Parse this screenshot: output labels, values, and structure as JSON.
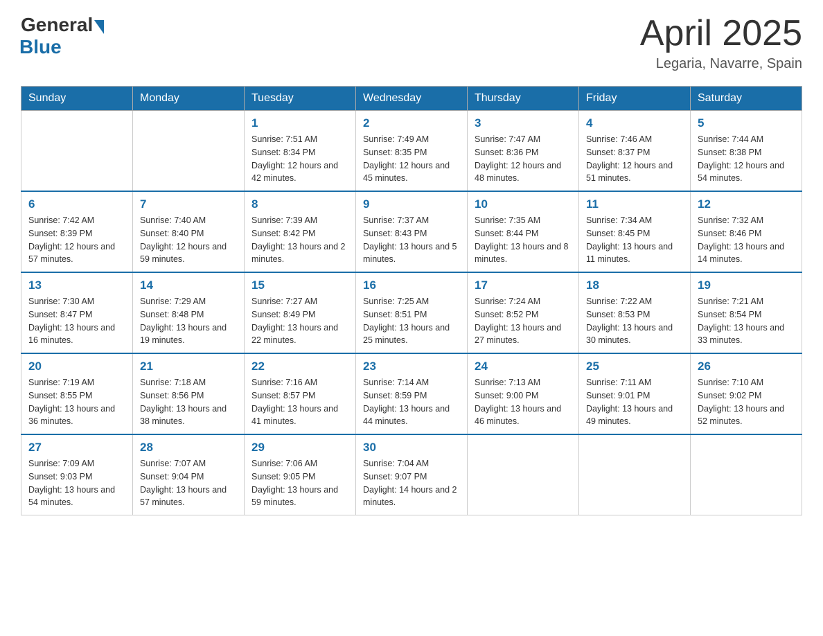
{
  "header": {
    "logo_general": "General",
    "logo_blue": "Blue",
    "title": "April 2025",
    "location": "Legaria, Navarre, Spain"
  },
  "weekdays": [
    "Sunday",
    "Monday",
    "Tuesday",
    "Wednesday",
    "Thursday",
    "Friday",
    "Saturday"
  ],
  "weeks": [
    [
      {
        "day": "",
        "sunrise": "",
        "sunset": "",
        "daylight": ""
      },
      {
        "day": "",
        "sunrise": "",
        "sunset": "",
        "daylight": ""
      },
      {
        "day": "1",
        "sunrise": "Sunrise: 7:51 AM",
        "sunset": "Sunset: 8:34 PM",
        "daylight": "Daylight: 12 hours and 42 minutes."
      },
      {
        "day": "2",
        "sunrise": "Sunrise: 7:49 AM",
        "sunset": "Sunset: 8:35 PM",
        "daylight": "Daylight: 12 hours and 45 minutes."
      },
      {
        "day": "3",
        "sunrise": "Sunrise: 7:47 AM",
        "sunset": "Sunset: 8:36 PM",
        "daylight": "Daylight: 12 hours and 48 minutes."
      },
      {
        "day": "4",
        "sunrise": "Sunrise: 7:46 AM",
        "sunset": "Sunset: 8:37 PM",
        "daylight": "Daylight: 12 hours and 51 minutes."
      },
      {
        "day": "5",
        "sunrise": "Sunrise: 7:44 AM",
        "sunset": "Sunset: 8:38 PM",
        "daylight": "Daylight: 12 hours and 54 minutes."
      }
    ],
    [
      {
        "day": "6",
        "sunrise": "Sunrise: 7:42 AM",
        "sunset": "Sunset: 8:39 PM",
        "daylight": "Daylight: 12 hours and 57 minutes."
      },
      {
        "day": "7",
        "sunrise": "Sunrise: 7:40 AM",
        "sunset": "Sunset: 8:40 PM",
        "daylight": "Daylight: 12 hours and 59 minutes."
      },
      {
        "day": "8",
        "sunrise": "Sunrise: 7:39 AM",
        "sunset": "Sunset: 8:42 PM",
        "daylight": "Daylight: 13 hours and 2 minutes."
      },
      {
        "day": "9",
        "sunrise": "Sunrise: 7:37 AM",
        "sunset": "Sunset: 8:43 PM",
        "daylight": "Daylight: 13 hours and 5 minutes."
      },
      {
        "day": "10",
        "sunrise": "Sunrise: 7:35 AM",
        "sunset": "Sunset: 8:44 PM",
        "daylight": "Daylight: 13 hours and 8 minutes."
      },
      {
        "day": "11",
        "sunrise": "Sunrise: 7:34 AM",
        "sunset": "Sunset: 8:45 PM",
        "daylight": "Daylight: 13 hours and 11 minutes."
      },
      {
        "day": "12",
        "sunrise": "Sunrise: 7:32 AM",
        "sunset": "Sunset: 8:46 PM",
        "daylight": "Daylight: 13 hours and 14 minutes."
      }
    ],
    [
      {
        "day": "13",
        "sunrise": "Sunrise: 7:30 AM",
        "sunset": "Sunset: 8:47 PM",
        "daylight": "Daylight: 13 hours and 16 minutes."
      },
      {
        "day": "14",
        "sunrise": "Sunrise: 7:29 AM",
        "sunset": "Sunset: 8:48 PM",
        "daylight": "Daylight: 13 hours and 19 minutes."
      },
      {
        "day": "15",
        "sunrise": "Sunrise: 7:27 AM",
        "sunset": "Sunset: 8:49 PM",
        "daylight": "Daylight: 13 hours and 22 minutes."
      },
      {
        "day": "16",
        "sunrise": "Sunrise: 7:25 AM",
        "sunset": "Sunset: 8:51 PM",
        "daylight": "Daylight: 13 hours and 25 minutes."
      },
      {
        "day": "17",
        "sunrise": "Sunrise: 7:24 AM",
        "sunset": "Sunset: 8:52 PM",
        "daylight": "Daylight: 13 hours and 27 minutes."
      },
      {
        "day": "18",
        "sunrise": "Sunrise: 7:22 AM",
        "sunset": "Sunset: 8:53 PM",
        "daylight": "Daylight: 13 hours and 30 minutes."
      },
      {
        "day": "19",
        "sunrise": "Sunrise: 7:21 AM",
        "sunset": "Sunset: 8:54 PM",
        "daylight": "Daylight: 13 hours and 33 minutes."
      }
    ],
    [
      {
        "day": "20",
        "sunrise": "Sunrise: 7:19 AM",
        "sunset": "Sunset: 8:55 PM",
        "daylight": "Daylight: 13 hours and 36 minutes."
      },
      {
        "day": "21",
        "sunrise": "Sunrise: 7:18 AM",
        "sunset": "Sunset: 8:56 PM",
        "daylight": "Daylight: 13 hours and 38 minutes."
      },
      {
        "day": "22",
        "sunrise": "Sunrise: 7:16 AM",
        "sunset": "Sunset: 8:57 PM",
        "daylight": "Daylight: 13 hours and 41 minutes."
      },
      {
        "day": "23",
        "sunrise": "Sunrise: 7:14 AM",
        "sunset": "Sunset: 8:59 PM",
        "daylight": "Daylight: 13 hours and 44 minutes."
      },
      {
        "day": "24",
        "sunrise": "Sunrise: 7:13 AM",
        "sunset": "Sunset: 9:00 PM",
        "daylight": "Daylight: 13 hours and 46 minutes."
      },
      {
        "day": "25",
        "sunrise": "Sunrise: 7:11 AM",
        "sunset": "Sunset: 9:01 PM",
        "daylight": "Daylight: 13 hours and 49 minutes."
      },
      {
        "day": "26",
        "sunrise": "Sunrise: 7:10 AM",
        "sunset": "Sunset: 9:02 PM",
        "daylight": "Daylight: 13 hours and 52 minutes."
      }
    ],
    [
      {
        "day": "27",
        "sunrise": "Sunrise: 7:09 AM",
        "sunset": "Sunset: 9:03 PM",
        "daylight": "Daylight: 13 hours and 54 minutes."
      },
      {
        "day": "28",
        "sunrise": "Sunrise: 7:07 AM",
        "sunset": "Sunset: 9:04 PM",
        "daylight": "Daylight: 13 hours and 57 minutes."
      },
      {
        "day": "29",
        "sunrise": "Sunrise: 7:06 AM",
        "sunset": "Sunset: 9:05 PM",
        "daylight": "Daylight: 13 hours and 59 minutes."
      },
      {
        "day": "30",
        "sunrise": "Sunrise: 7:04 AM",
        "sunset": "Sunset: 9:07 PM",
        "daylight": "Daylight: 14 hours and 2 minutes."
      },
      {
        "day": "",
        "sunrise": "",
        "sunset": "",
        "daylight": ""
      },
      {
        "day": "",
        "sunrise": "",
        "sunset": "",
        "daylight": ""
      },
      {
        "day": "",
        "sunrise": "",
        "sunset": "",
        "daylight": ""
      }
    ]
  ]
}
